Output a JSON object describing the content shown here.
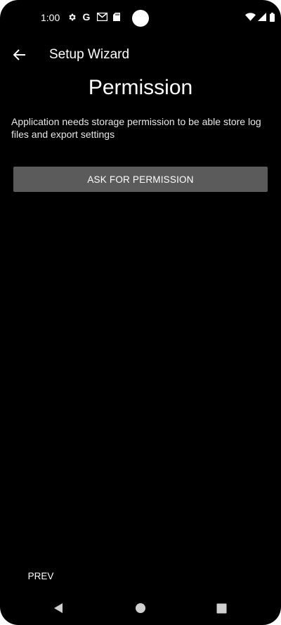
{
  "status_bar": {
    "time": "1:00",
    "left_icons": [
      "gear-icon",
      "google-icon",
      "gmail-icon",
      "sd-card-icon"
    ],
    "right_icons": [
      "wifi-icon",
      "signal-icon",
      "battery-icon"
    ]
  },
  "app_bar": {
    "title": "Setup Wizard",
    "back_icon": "arrow-left-icon"
  },
  "main": {
    "heading": "Permission",
    "description": "Application needs storage permission to be able store log files and export settings",
    "ask_button_label": "ASK FOR PERMISSION"
  },
  "footer": {
    "prev_label": "PREV"
  },
  "nav_bar": {
    "icons": [
      "back-triangle-icon",
      "home-circle-icon",
      "recents-square-icon"
    ]
  },
  "colors": {
    "background": "#000000",
    "button": "#5b5b5b",
    "text": "#ffffff"
  }
}
